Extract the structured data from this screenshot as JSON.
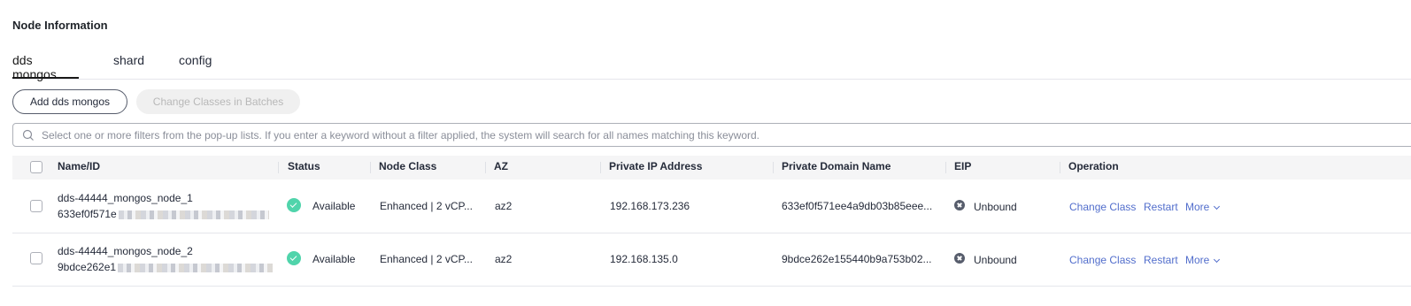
{
  "section": {
    "title": "Node Information"
  },
  "tabs": [
    {
      "label": "dds mongos",
      "active": true
    },
    {
      "label": "shard",
      "active": false
    },
    {
      "label": "config",
      "active": false
    }
  ],
  "toolbar": {
    "add_label": "Add dds mongos",
    "change_batch_label": "Change Classes in Batches"
  },
  "search": {
    "placeholder": "Select one or more filters from the pop-up lists. If you enter a keyword without a filter applied, the system will search for all names matching this keyword.",
    "icon": "search-icon"
  },
  "table": {
    "columns": [
      "Name/ID",
      "Status",
      "Node Class",
      "AZ",
      "Private IP Address",
      "Private Domain Name",
      "EIP",
      "Operation"
    ],
    "rows": [
      {
        "name": "dds-44444_mongos_node_1",
        "id": "633ef0f571e",
        "status": "Available",
        "node_class": "Enhanced | 2 vCP...",
        "az": "az2",
        "private_ip": "192.168.173.236",
        "domain": "633ef0f571ee4a9db03b85eee...",
        "eip": "Unbound",
        "ops": {
          "change": "Change Class",
          "restart": "Restart",
          "more": "More"
        }
      },
      {
        "name": "dds-44444_mongos_node_2",
        "id": "9bdce262e1",
        "status": "Available",
        "node_class": "Enhanced | 2 vCP...",
        "az": "az2",
        "private_ip": "192.168.135.0",
        "domain": "9bdce262e155440b9a753b02...",
        "eip": "Unbound",
        "ops": {
          "change": "Change Class",
          "restart": "Restart",
          "more": "More"
        }
      }
    ]
  },
  "colors": {
    "status_available": "#50d4ab",
    "link": "#526ecc",
    "tab_active_underline": "#191919",
    "header_bg": "#f5f5f6"
  }
}
